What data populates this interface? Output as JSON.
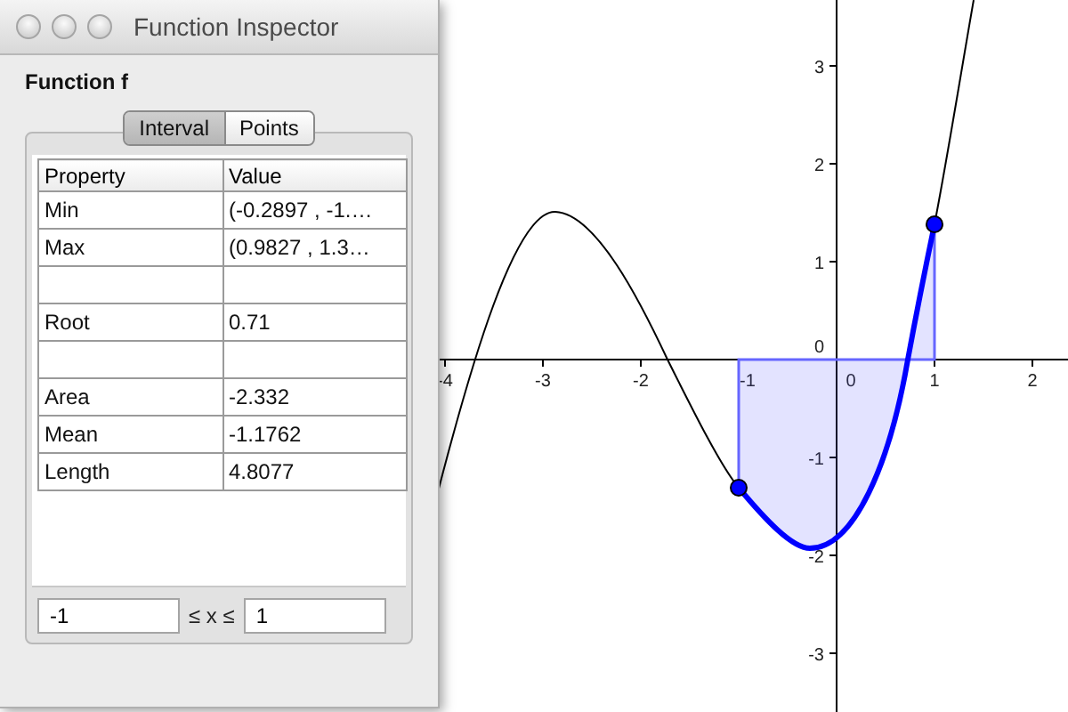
{
  "window": {
    "title": "Function Inspector"
  },
  "function_label": "Function f",
  "tabs": [
    {
      "label": "Interval",
      "selected": true
    },
    {
      "label": "Points",
      "selected": false
    }
  ],
  "table": {
    "columns": [
      "Property",
      "Value"
    ],
    "rows": [
      {
        "kind": "entry",
        "property": "Min",
        "value": "(-0.2897 , -1.…"
      },
      {
        "kind": "entry",
        "property": "Max",
        "value": "(0.9827 , 1.3…"
      },
      {
        "kind": "blank"
      },
      {
        "kind": "entry",
        "property": "Root",
        "value": "0.71"
      },
      {
        "kind": "blank"
      },
      {
        "kind": "entry",
        "property": "Area",
        "value": "-2.332"
      },
      {
        "kind": "entry",
        "property": "Mean",
        "value": "-1.1762"
      },
      {
        "kind": "entry",
        "property": "Length",
        "value": "4.8077"
      }
    ]
  },
  "interval": {
    "lower": "-1",
    "relation": "≤ x ≤",
    "upper": "1"
  },
  "graph": {
    "x_tick_labels": [
      "-4",
      "-3",
      "-2",
      "-1",
      "0",
      "1",
      "2"
    ],
    "y_tick_labels": [
      "3",
      "2",
      "1",
      "0",
      "-1",
      "-2",
      "-3"
    ]
  }
}
